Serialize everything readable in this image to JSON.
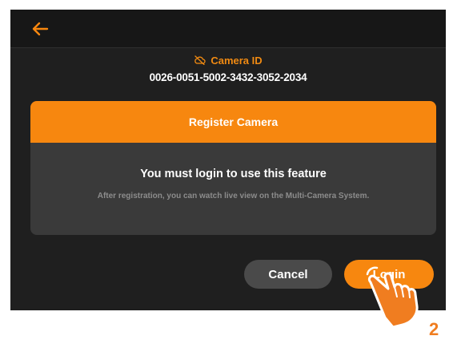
{
  "header": {
    "back_icon": "arrow-left-icon"
  },
  "camera": {
    "status_icon": "cloud-off-icon",
    "label": "Camera ID",
    "id": "0026-0051-5002-3432-3052-2034"
  },
  "dialog": {
    "header_title": "Register Camera",
    "title": "You must login to use this feature",
    "description": "After registration, you can watch live view on the Multi-Camera System."
  },
  "actions": {
    "cancel_label": "Cancel",
    "login_label": "Login"
  },
  "annotation": {
    "step_number": "2",
    "pointer_icon": "tap-hand-icon"
  },
  "colors": {
    "accent": "#f7870f",
    "screen_bg": "#1f1f1f",
    "topbar_bg": "#171717",
    "dialog_bg": "#3a3a3a",
    "cancel_bg": "#4a4a4a"
  }
}
